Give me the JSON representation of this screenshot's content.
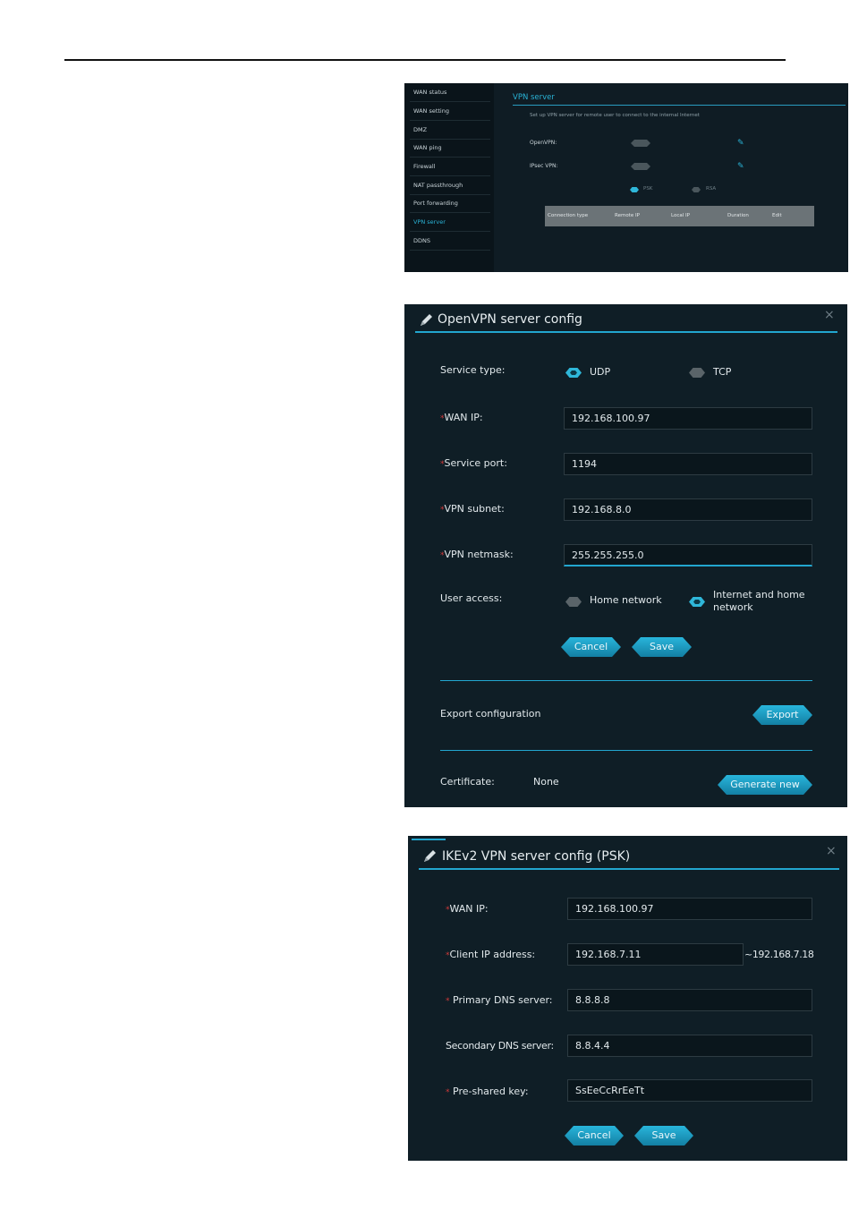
{
  "vpn_server_page": {
    "nav": [
      "WAN status",
      "WAN setting",
      "DMZ",
      "WAN ping",
      "Firewall",
      "NAT passthrough",
      "Port forwarding",
      "VPN server",
      "DDNS"
    ],
    "active_nav": "VPN server",
    "title": "VPN server",
    "description": "Set up VPN server for remote user to connect to the internal Internet",
    "rows": [
      {
        "label": "OpenVPN:",
        "toggle": "off"
      },
      {
        "label": "IPsec VPN:",
        "toggle": "off"
      }
    ],
    "auth_options": [
      {
        "label": "PSK",
        "selected": true
      },
      {
        "label": "RSA",
        "selected": false
      }
    ],
    "table_headers": [
      "Connection type",
      "Remote IP",
      "Local IP",
      "Duration",
      "Edit"
    ]
  },
  "openvpn_dialog": {
    "title": "OpenVPN server config",
    "close": "×",
    "service_type_label": "Service type:",
    "service_types": [
      {
        "label": "UDP",
        "selected": true
      },
      {
        "label": "TCP",
        "selected": false
      }
    ],
    "required_mark": "*",
    "fields": [
      {
        "label": "WAN IP:",
        "value": "192.168.100.97",
        "required": true
      },
      {
        "label": "Service port:",
        "value": "1194",
        "required": true
      },
      {
        "label": "VPN subnet:",
        "value": "192.168.8.0",
        "required": true
      },
      {
        "label": "VPN netmask:",
        "value": "255.255.255.0",
        "required": true
      }
    ],
    "user_access_label": "User access:",
    "user_access_options": [
      {
        "label": "Home network",
        "selected": false
      },
      {
        "label": "Internet and home network",
        "selected": true
      }
    ],
    "cancel_label": "Cancel",
    "save_label": "Save",
    "export_label": "Export configuration",
    "export_button": "Export",
    "certificate_label": "Certificate:",
    "certificate_value": "None",
    "generate_button": "Generate new"
  },
  "ikev2_dialog": {
    "title": "IKEv2 VPN server config (PSK)",
    "close": "×",
    "required_mark": "*",
    "fields": [
      {
        "label": "WAN IP:",
        "value": "192.168.100.97",
        "required": true
      },
      {
        "label": "Client IP address:",
        "value": "192.168.7.11",
        "suffix": "~192.168.7.18",
        "required": true
      },
      {
        "label": "Primary DNS server:",
        "value": "8.8.8.8",
        "required": true
      },
      {
        "label": "Secondary DNS server:",
        "value": "8.8.4.4",
        "required": false
      },
      {
        "label": "Pre-shared key:",
        "value": "SsEeCcRrEeTt",
        "required": true
      }
    ],
    "cancel_label": "Cancel",
    "save_label": "Save"
  },
  "colors": {
    "accent": "#22a6cf",
    "panel": "#0f1e26",
    "required": "#d23a3a"
  }
}
